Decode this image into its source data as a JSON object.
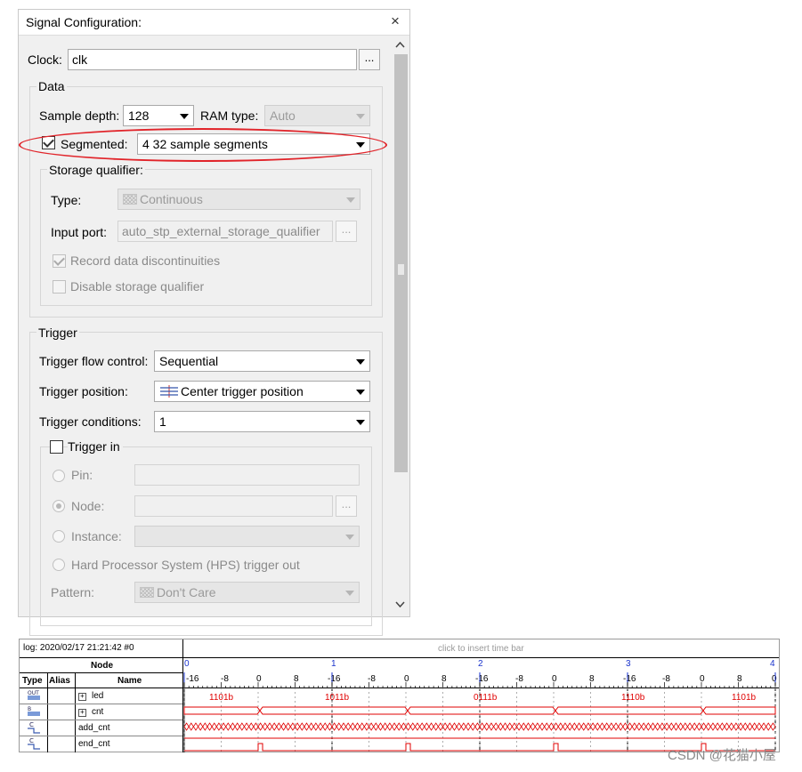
{
  "panel": {
    "title": "Signal Configuration:",
    "close_glyph": "×",
    "scroll_up": "^",
    "scroll_down": "v",
    "clock_label": "Clock:",
    "clock_value": "clk",
    "browse": "...",
    "data_group": "Data",
    "sample_depth_label": "Sample depth:",
    "sample_depth_value": "128",
    "ram_type_label": "RAM type:",
    "ram_type_value": "Auto",
    "segmented_label": "Segmented:",
    "segmented_checked": true,
    "segmented_value": "4  32 sample segments",
    "storage_group": "Storage qualifier:",
    "type_label": "Type:",
    "type_value": "Continuous",
    "input_port_label": "Input port:",
    "input_port_value": "auto_stp_external_storage_qualifier",
    "record_label": "Record data discontinuities",
    "record_checked": true,
    "disable_label": "Disable storage qualifier",
    "disable_checked": false,
    "trigger_group": "Trigger",
    "flow_label": "Trigger flow control:",
    "flow_value": "Sequential",
    "position_label": "Trigger position:",
    "position_value": "Center trigger position",
    "conditions_label": "Trigger conditions:",
    "conditions_value": "1",
    "trigger_in_label": "Trigger in",
    "trigger_in_checked": false,
    "pin_label": "Pin:",
    "node_label": "Node:",
    "node_selected": true,
    "instance_label": "Instance:",
    "hps_label": "Hard Processor System (HPS) trigger out",
    "pattern_label": "Pattern:",
    "pattern_value": "Don't Care",
    "highlight_color": "#e1242a"
  },
  "waveform": {
    "log": "log: 2020/02/17 21:21:42  #0",
    "insert_hint": "click to insert time bar",
    "node_header": "Node",
    "col_type": "Type",
    "col_alias": "Alias",
    "col_name": "Name",
    "segment_markers": [
      "0",
      "1",
      "2",
      "3",
      "4"
    ],
    "ticks": [
      "-16",
      "-8",
      "0",
      "8"
    ],
    "expand_glyph": "+",
    "signals": [
      {
        "name": "led",
        "expandable": true,
        "kind": "bus",
        "values": [
          "1101b",
          "1011b",
          "0111b",
          "1110b",
          "1101b"
        ]
      },
      {
        "name": "cnt",
        "expandable": true,
        "kind": "bus_toggling"
      },
      {
        "name": "add_cnt",
        "expandable": false,
        "kind": "high"
      },
      {
        "name": "end_cnt",
        "expandable": false,
        "kind": "pulse"
      }
    ],
    "trace_color": "#e00000",
    "marker_color": "#1a33cc"
  },
  "watermark": "CSDN @花猫小屋"
}
